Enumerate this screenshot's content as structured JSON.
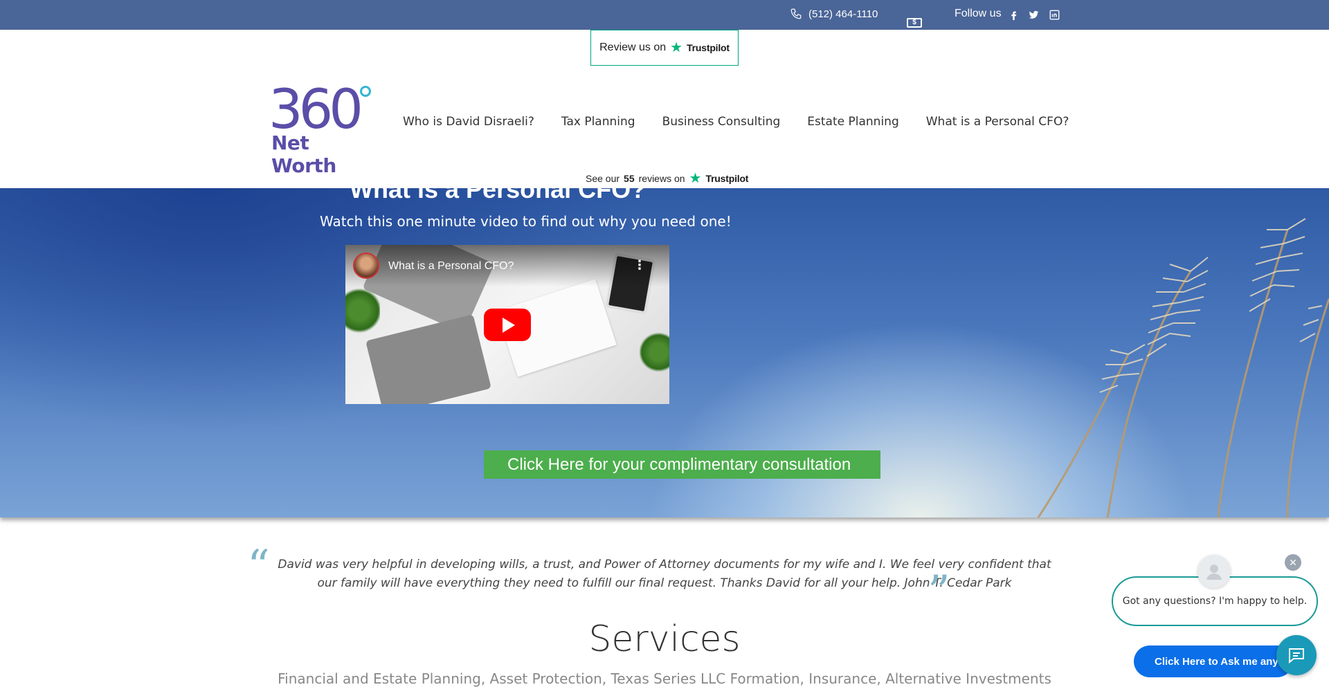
{
  "topbar": {
    "phone": "(512) 464-1110",
    "follow_label": "Follow us",
    "social": [
      "facebook-icon",
      "twitter-icon",
      "linkedin-icon"
    ],
    "bg_color": "#4a6597"
  },
  "header": {
    "review_btn_prefix": "Review us on",
    "trustpilot_word": "Trustpilot",
    "logo": {
      "number": "360",
      "text": "Net Worth"
    },
    "nav": [
      {
        "label": "Who is David Disraeli?"
      },
      {
        "label": "Tax Planning"
      },
      {
        "label": "Business Consulting"
      },
      {
        "label": "Estate Planning"
      },
      {
        "label": "What is a Personal CFO?"
      }
    ],
    "see_reviews": {
      "prefix": "See our",
      "count": "55",
      "suffix": "reviews on"
    }
  },
  "hero": {
    "title": "What is a Personal CFO?",
    "subtitle": "Watch this one minute video to find out why you need one!",
    "video_title": "What is a Personal CFO?",
    "cta": "Click Here for your complimentary consultation",
    "cta_color": "#4cae4c"
  },
  "testimonial": {
    "text": "David was very helpful in developing wills, a trust, and Power of Attorney documents for my wife and I. We feel very confident that our family will have everything they need to fulfill our final request. Thanks David for all your help. John T. Cedar Park"
  },
  "services": {
    "title": "Services",
    "subtitle": "Financial and Estate Planning, Asset Protection, Texas Series LLC Formation, Insurance, Alternative Investments"
  },
  "chat": {
    "bubble": "Got any questions? I'm happy to help.",
    "ask_button": "Click Here to Ask me anyt!",
    "accent_color": "#0a6fe8"
  }
}
